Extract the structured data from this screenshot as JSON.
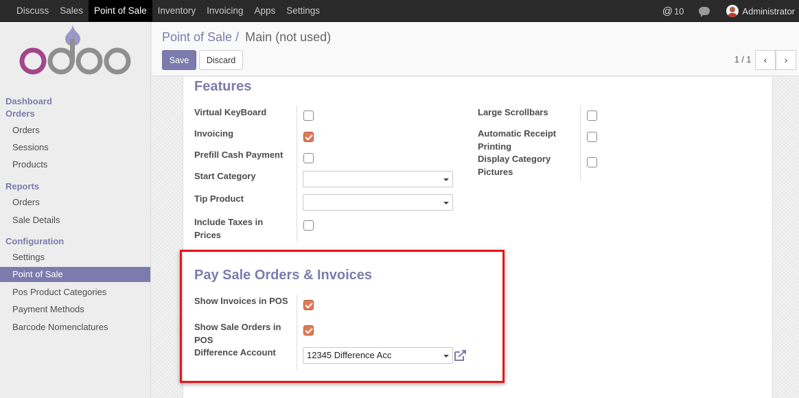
{
  "topbar": {
    "menu": [
      "Discuss",
      "Sales",
      "Point of Sale",
      "Inventory",
      "Invoicing",
      "Apps",
      "Settings"
    ],
    "active": "Point of Sale",
    "messages_count": "10",
    "user": "Administrator"
  },
  "sidebar": {
    "dashboard": "Dashboard",
    "orders_section": "Orders",
    "orders_items": [
      "Orders",
      "Sessions",
      "Products"
    ],
    "reports_section": "Reports",
    "reports_items": [
      "Orders",
      "Sale Details"
    ],
    "config_section": "Configuration",
    "config_items": [
      "Settings",
      "Point of Sale",
      "Pos Product Categories",
      "Payment Methods",
      "Barcode Nomenclatures"
    ],
    "active_item": "Point of Sale"
  },
  "control_panel": {
    "breadcrumb_parent": "Point of Sale /",
    "breadcrumb_current": "Main (not used)",
    "save_label": "Save",
    "discard_label": "Discard",
    "pager": "1 / 1"
  },
  "features": {
    "title": "Features",
    "left": [
      {
        "label": "Virtual KeyBoard",
        "checked": false
      },
      {
        "label": "Invoicing",
        "checked": true
      },
      {
        "label": "Prefill Cash Payment",
        "checked": false
      },
      {
        "label": "Start Category",
        "value": ""
      },
      {
        "label": "Tip Product",
        "value": ""
      },
      {
        "label": "Include Taxes in Prices",
        "checked": false
      }
    ],
    "right": [
      {
        "label": "Large Scrollbars",
        "checked": false
      },
      {
        "label": "Automatic Receipt Printing",
        "checked": false
      },
      {
        "label": "Display Category Pictures",
        "checked": false
      }
    ]
  },
  "pay_section": {
    "title": "Pay Sale Orders & Invoices",
    "show_invoices": {
      "label": "Show Invoices in POS",
      "checked": true
    },
    "show_sale_orders": {
      "label": "Show Sale Orders in POS",
      "checked": true
    },
    "difference_account": {
      "label": "Difference Account",
      "value": "12345 Difference Acc"
    }
  },
  "colors": {
    "brand": "#7c7bad",
    "checkbox_checked": "#e07b56",
    "highlight": "#e8121a"
  }
}
